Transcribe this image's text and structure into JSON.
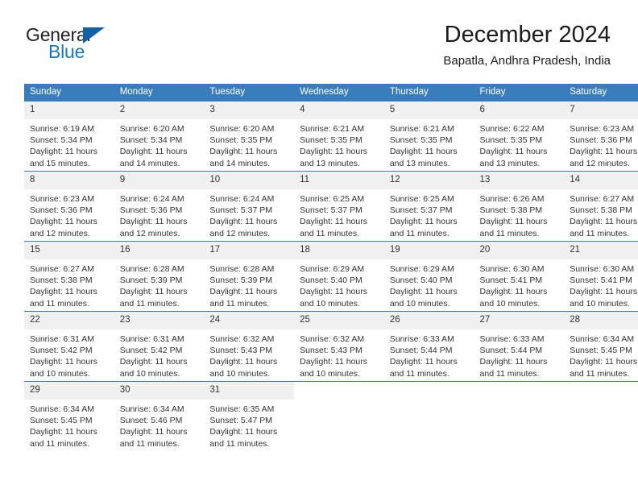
{
  "brand": {
    "name_part1": "General",
    "name_part2": "Blue",
    "accent_color": "#1878be",
    "triangle_color": "#1161a4"
  },
  "header": {
    "title": "December 2024",
    "subtitle": "Bapatla, Andhra Pradesh, India"
  },
  "calendar": {
    "header_bg": "#3a7dbd",
    "daynum_bg": "#f0f0f0",
    "weekdays": [
      "Sunday",
      "Monday",
      "Tuesday",
      "Wednesday",
      "Thursday",
      "Friday",
      "Saturday"
    ],
    "weeks": [
      [
        {
          "day": "1",
          "sunrise": "Sunrise: 6:19 AM",
          "sunset": "Sunset: 5:34 PM",
          "daylight1": "Daylight: 11 hours",
          "daylight2": "and 15 minutes."
        },
        {
          "day": "2",
          "sunrise": "Sunrise: 6:20 AM",
          "sunset": "Sunset: 5:34 PM",
          "daylight1": "Daylight: 11 hours",
          "daylight2": "and 14 minutes."
        },
        {
          "day": "3",
          "sunrise": "Sunrise: 6:20 AM",
          "sunset": "Sunset: 5:35 PM",
          "daylight1": "Daylight: 11 hours",
          "daylight2": "and 14 minutes."
        },
        {
          "day": "4",
          "sunrise": "Sunrise: 6:21 AM",
          "sunset": "Sunset: 5:35 PM",
          "daylight1": "Daylight: 11 hours",
          "daylight2": "and 13 minutes."
        },
        {
          "day": "5",
          "sunrise": "Sunrise: 6:21 AM",
          "sunset": "Sunset: 5:35 PM",
          "daylight1": "Daylight: 11 hours",
          "daylight2": "and 13 minutes."
        },
        {
          "day": "6",
          "sunrise": "Sunrise: 6:22 AM",
          "sunset": "Sunset: 5:35 PM",
          "daylight1": "Daylight: 11 hours",
          "daylight2": "and 13 minutes."
        },
        {
          "day": "7",
          "sunrise": "Sunrise: 6:23 AM",
          "sunset": "Sunset: 5:36 PM",
          "daylight1": "Daylight: 11 hours",
          "daylight2": "and 12 minutes."
        }
      ],
      [
        {
          "day": "8",
          "sunrise": "Sunrise: 6:23 AM",
          "sunset": "Sunset: 5:36 PM",
          "daylight1": "Daylight: 11 hours",
          "daylight2": "and 12 minutes."
        },
        {
          "day": "9",
          "sunrise": "Sunrise: 6:24 AM",
          "sunset": "Sunset: 5:36 PM",
          "daylight1": "Daylight: 11 hours",
          "daylight2": "and 12 minutes."
        },
        {
          "day": "10",
          "sunrise": "Sunrise: 6:24 AM",
          "sunset": "Sunset: 5:37 PM",
          "daylight1": "Daylight: 11 hours",
          "daylight2": "and 12 minutes."
        },
        {
          "day": "11",
          "sunrise": "Sunrise: 6:25 AM",
          "sunset": "Sunset: 5:37 PM",
          "daylight1": "Daylight: 11 hours",
          "daylight2": "and 11 minutes."
        },
        {
          "day": "12",
          "sunrise": "Sunrise: 6:25 AM",
          "sunset": "Sunset: 5:37 PM",
          "daylight1": "Daylight: 11 hours",
          "daylight2": "and 11 minutes."
        },
        {
          "day": "13",
          "sunrise": "Sunrise: 6:26 AM",
          "sunset": "Sunset: 5:38 PM",
          "daylight1": "Daylight: 11 hours",
          "daylight2": "and 11 minutes."
        },
        {
          "day": "14",
          "sunrise": "Sunrise: 6:27 AM",
          "sunset": "Sunset: 5:38 PM",
          "daylight1": "Daylight: 11 hours",
          "daylight2": "and 11 minutes."
        }
      ],
      [
        {
          "day": "15",
          "sunrise": "Sunrise: 6:27 AM",
          "sunset": "Sunset: 5:38 PM",
          "daylight1": "Daylight: 11 hours",
          "daylight2": "and 11 minutes."
        },
        {
          "day": "16",
          "sunrise": "Sunrise: 6:28 AM",
          "sunset": "Sunset: 5:39 PM",
          "daylight1": "Daylight: 11 hours",
          "daylight2": "and 11 minutes."
        },
        {
          "day": "17",
          "sunrise": "Sunrise: 6:28 AM",
          "sunset": "Sunset: 5:39 PM",
          "daylight1": "Daylight: 11 hours",
          "daylight2": "and 11 minutes."
        },
        {
          "day": "18",
          "sunrise": "Sunrise: 6:29 AM",
          "sunset": "Sunset: 5:40 PM",
          "daylight1": "Daylight: 11 hours",
          "daylight2": "and 10 minutes."
        },
        {
          "day": "19",
          "sunrise": "Sunrise: 6:29 AM",
          "sunset": "Sunset: 5:40 PM",
          "daylight1": "Daylight: 11 hours",
          "daylight2": "and 10 minutes."
        },
        {
          "day": "20",
          "sunrise": "Sunrise: 6:30 AM",
          "sunset": "Sunset: 5:41 PM",
          "daylight1": "Daylight: 11 hours",
          "daylight2": "and 10 minutes."
        },
        {
          "day": "21",
          "sunrise": "Sunrise: 6:30 AM",
          "sunset": "Sunset: 5:41 PM",
          "daylight1": "Daylight: 11 hours",
          "daylight2": "and 10 minutes."
        }
      ],
      [
        {
          "day": "22",
          "sunrise": "Sunrise: 6:31 AM",
          "sunset": "Sunset: 5:42 PM",
          "daylight1": "Daylight: 11 hours",
          "daylight2": "and 10 minutes."
        },
        {
          "day": "23",
          "sunrise": "Sunrise: 6:31 AM",
          "sunset": "Sunset: 5:42 PM",
          "daylight1": "Daylight: 11 hours",
          "daylight2": "and 10 minutes."
        },
        {
          "day": "24",
          "sunrise": "Sunrise: 6:32 AM",
          "sunset": "Sunset: 5:43 PM",
          "daylight1": "Daylight: 11 hours",
          "daylight2": "and 10 minutes."
        },
        {
          "day": "25",
          "sunrise": "Sunrise: 6:32 AM",
          "sunset": "Sunset: 5:43 PM",
          "daylight1": "Daylight: 11 hours",
          "daylight2": "and 10 minutes."
        },
        {
          "day": "26",
          "sunrise": "Sunrise: 6:33 AM",
          "sunset": "Sunset: 5:44 PM",
          "daylight1": "Daylight: 11 hours",
          "daylight2": "and 11 minutes."
        },
        {
          "day": "27",
          "sunrise": "Sunrise: 6:33 AM",
          "sunset": "Sunset: 5:44 PM",
          "daylight1": "Daylight: 11 hours",
          "daylight2": "and 11 minutes."
        },
        {
          "day": "28",
          "sunrise": "Sunrise: 6:34 AM",
          "sunset": "Sunset: 5:45 PM",
          "daylight1": "Daylight: 11 hours",
          "daylight2": "and 11 minutes."
        }
      ],
      [
        {
          "day": "29",
          "sunrise": "Sunrise: 6:34 AM",
          "sunset": "Sunset: 5:45 PM",
          "daylight1": "Daylight: 11 hours",
          "daylight2": "and 11 minutes."
        },
        {
          "day": "30",
          "sunrise": "Sunrise: 6:34 AM",
          "sunset": "Sunset: 5:46 PM",
          "daylight1": "Daylight: 11 hours",
          "daylight2": "and 11 minutes."
        },
        {
          "day": "31",
          "sunrise": "Sunrise: 6:35 AM",
          "sunset": "Sunset: 5:47 PM",
          "daylight1": "Daylight: 11 hours",
          "daylight2": "and 11 minutes."
        },
        {
          "day": "",
          "sunrise": "",
          "sunset": "",
          "daylight1": "",
          "daylight2": ""
        },
        {
          "day": "",
          "sunrise": "",
          "sunset": "",
          "daylight1": "",
          "daylight2": ""
        },
        {
          "day": "",
          "sunrise": "",
          "sunset": "",
          "daylight1": "",
          "daylight2": ""
        },
        {
          "day": "",
          "sunrise": "",
          "sunset": "",
          "daylight1": "",
          "daylight2": ""
        }
      ]
    ]
  }
}
